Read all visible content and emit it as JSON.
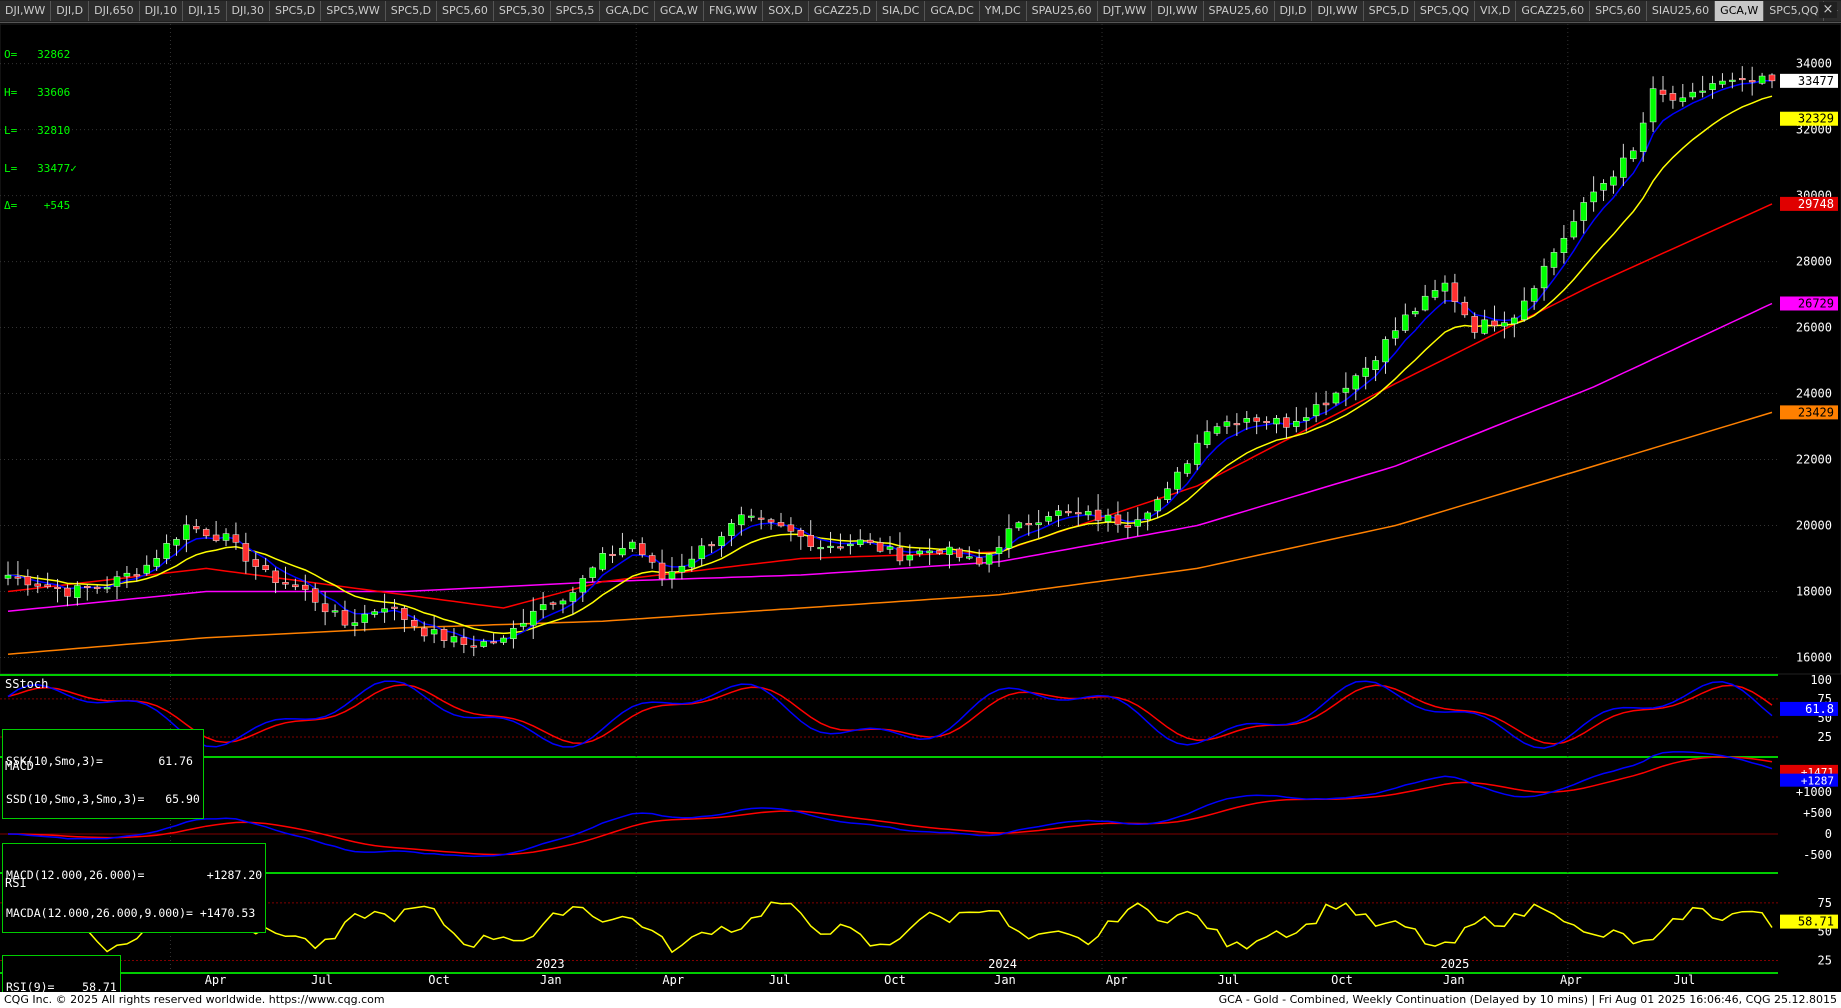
{
  "tabs": [
    "DJI,WW",
    "DJI,D",
    "DJI,650",
    "DJI,10",
    "DJI,15",
    "DJI,30",
    "SPC5,D",
    "SPC5,WW",
    "SPC5,D",
    "SPC5,60",
    "SPC5,30",
    "SPC5,5",
    "GCA,DC",
    "GCA,W",
    "FNG,WW",
    "SOX,D",
    "GCAZ25,D",
    "SIA,DC",
    "GCA,DC",
    "YM,DC",
    "SPAU25,60",
    "DJT,WW",
    "DJI,WW",
    "SPAU25,60",
    "DJI,D",
    "DJI,WW",
    "SPC5,D",
    "SPC5,QQ",
    "VIX,D",
    "GCAZ25,60",
    "SPC5,60",
    "SIAU25,60",
    "GCA,W",
    "SPC5,QQ",
    "+"
  ],
  "active_tab": "GCA,W",
  "window_close": "×",
  "ohlc": {
    "open": "O=   32862",
    "high": "H=   33606",
    "low": "L=   32810",
    "last": "L=   33477✓",
    "change": "Δ=    +545"
  },
  "panels": {
    "stoch_title": "SStoch",
    "stoch_k": "SSK(10,Smo,3)=        61.76",
    "stoch_d": "SSD(10,Smo,3,Smo,3)=   65.90",
    "macd_title": "MACD",
    "macd_line": "MACD(12.000,26.000)=         +1287.20",
    "macd_avg": "MACDA(12.000,26.000,9.000)= +1470.53",
    "rsi_title": "RSI",
    "rsi_line": "RSI(9)=    58.71"
  },
  "footer": {
    "left": "CQG Inc. © 2025 All rights reserved worldwide. https://www.cqg.com",
    "right": "GCA - Gold - Combined, Weekly Continuation (Delayed by 10 mins) | Fri Aug 01 2025 16:06:46, CQG 25.12.8015"
  },
  "price_axis_labels": [
    "34000",
    "32000",
    "30000",
    "28000",
    "26000",
    "24000",
    "22000",
    "20000",
    "18000",
    "16000"
  ],
  "price_badges": [
    {
      "value": "33477",
      "color": "#ffffff",
      "bg": "#ffffff",
      "text": "#000000",
      "y": 33477
    },
    {
      "value": "32329",
      "color": "#ffff00",
      "bg": "#ffff00",
      "text": "#000000",
      "y": 32329
    },
    {
      "value": "29748",
      "color": "#ff0000",
      "bg": "#e00000",
      "text": "#ffffff",
      "y": 29748
    },
    {
      "value": "26729",
      "color": "#ff00ff",
      "bg": "#ff00ff",
      "text": "#000000",
      "y": 26729
    },
    {
      "value": "23429",
      "color": "#ff8000",
      "bg": "#ff8000",
      "text": "#000000",
      "y": 23429
    }
  ],
  "stoch_axis_labels": [
    "100",
    "75",
    "50",
    "25"
  ],
  "stoch_badge": "61.8",
  "macd_axis_labels": [
    "+1000",
    "+500",
    "0",
    "-500"
  ],
  "macd_badges": [
    "+1471",
    "+1287"
  ],
  "rsi_axis_labels": [
    "75",
    "50",
    "25"
  ],
  "rsi_badge": "58.71",
  "time_axis": {
    "months": [
      "Jan",
      "Apr",
      "Jul",
      "Oct",
      "Jan",
      "Apr",
      "Jul",
      "Oct",
      "Jan",
      "Apr",
      "Jul",
      "Oct",
      "Jan",
      "Apr",
      "Jul"
    ],
    "years": [
      "2023",
      "2024",
      "2025"
    ]
  },
  "colors": {
    "up": "#00ff00",
    "down": "#ff3030",
    "ma_blue": "#0000ff",
    "ma_yellow": "#ffff00",
    "ma_red": "#ff0000",
    "ma_magenta": "#ff00ff",
    "ma_orange": "#ff8000",
    "stoch_k": "#0000ff",
    "stoch_d": "#ff0000",
    "macd": "#0000ff",
    "macd_avg": "#ff0000",
    "rsi": "#ffff00",
    "panel_border": "#00cc00"
  },
  "chart_data": {
    "type": "candlestick",
    "title": "GCA - Gold - Combined, Weekly Continuation",
    "y_range": [
      15500,
      35200
    ],
    "price_anchors": [
      [
        0,
        18500
      ],
      [
        6,
        18000
      ],
      [
        10,
        18200
      ],
      [
        14,
        18800
      ],
      [
        18,
        20000
      ],
      [
        22,
        19600
      ],
      [
        26,
        18500
      ],
      [
        30,
        18000
      ],
      [
        34,
        17000
      ],
      [
        38,
        17600
      ],
      [
        42,
        16800
      ],
      [
        46,
        16400
      ],
      [
        50,
        16500
      ],
      [
        53,
        17500
      ],
      [
        57,
        18000
      ],
      [
        60,
        19000
      ],
      [
        63,
        19500
      ],
      [
        66,
        18400
      ],
      [
        70,
        19300
      ],
      [
        74,
        20200
      ],
      [
        78,
        19900
      ],
      [
        82,
        19400
      ],
      [
        86,
        19500
      ],
      [
        90,
        19100
      ],
      [
        94,
        19300
      ],
      [
        98,
        18800
      ],
      [
        101,
        19800
      ],
      [
        105,
        20400
      ],
      [
        109,
        20300
      ],
      [
        113,
        20100
      ],
      [
        117,
        21000
      ],
      [
        121,
        23000
      ],
      [
        125,
        23300
      ],
      [
        129,
        23100
      ],
      [
        133,
        23800
      ],
      [
        137,
        24800
      ],
      [
        141,
        26300
      ],
      [
        145,
        27300
      ],
      [
        148,
        26000
      ],
      [
        152,
        26400
      ],
      [
        156,
        28300
      ],
      [
        160,
        30100
      ],
      [
        164,
        31300
      ],
      [
        166,
        33100
      ],
      [
        169,
        32800
      ],
      [
        172,
        33400
      ],
      [
        175,
        33400
      ],
      [
        178,
        33477
      ]
    ],
    "moving_averages": [
      {
        "color": "#ff00ff",
        "anchors": [
          [
            0,
            17400
          ],
          [
            20,
            18000
          ],
          [
            40,
            18000
          ],
          [
            60,
            18300
          ],
          [
            80,
            18500
          ],
          [
            100,
            18900
          ],
          [
            120,
            20000
          ],
          [
            140,
            21800
          ],
          [
            160,
            24200
          ],
          [
            178,
            26729
          ]
        ]
      },
      {
        "color": "#ff8000",
        "anchors": [
          [
            0,
            16100
          ],
          [
            20,
            16600
          ],
          [
            40,
            16900
          ],
          [
            60,
            17100
          ],
          [
            80,
            17500
          ],
          [
            100,
            17900
          ],
          [
            120,
            18700
          ],
          [
            140,
            20000
          ],
          [
            160,
            21800
          ],
          [
            178,
            23429
          ]
        ]
      },
      {
        "color": "#ff0000",
        "anchors": [
          [
            0,
            18000
          ],
          [
            20,
            18700
          ],
          [
            40,
            17900
          ],
          [
            50,
            17500
          ],
          [
            60,
            18300
          ],
          [
            80,
            19000
          ],
          [
            100,
            19200
          ],
          [
            120,
            21200
          ],
          [
            140,
            24300
          ],
          [
            160,
            27300
          ],
          [
            178,
            29748
          ]
        ]
      }
    ],
    "stoch_range": [
      0,
      105
    ],
    "macd_range": [
      -900,
      1800
    ],
    "rsi_range": [
      15,
      100
    ]
  }
}
